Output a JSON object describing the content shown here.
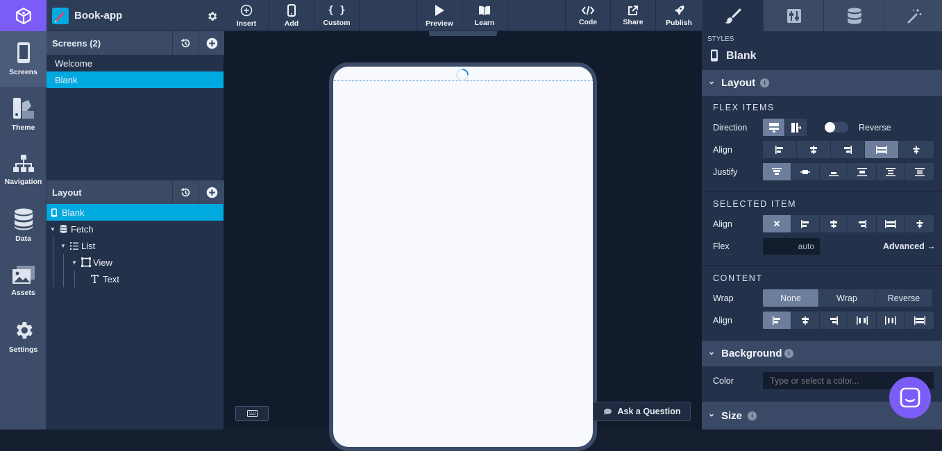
{
  "rail": {
    "items": [
      {
        "label": "Screens",
        "icon": "phone-icon"
      },
      {
        "label": "Theme",
        "icon": "theme-icon"
      },
      {
        "label": "Navigation",
        "icon": "sitemap-icon"
      },
      {
        "label": "Data",
        "icon": "database-icon"
      },
      {
        "label": "Assets",
        "icon": "images-icon"
      },
      {
        "label": "Settings",
        "icon": "gear-icon"
      }
    ]
  },
  "app": {
    "name": "Book-app"
  },
  "screens": {
    "title": "Screens (2)",
    "items": [
      "Welcome",
      "Blank"
    ],
    "selected": "Blank"
  },
  "layout_tree": {
    "title": "Layout",
    "nodes": [
      {
        "label": "Blank",
        "icon": "phone-icon"
      },
      {
        "label": "Fetch",
        "icon": "database-icon"
      },
      {
        "label": "List",
        "icon": "list-icon"
      },
      {
        "label": "View",
        "icon": "view-icon"
      },
      {
        "label": "Text",
        "icon": "text-icon"
      }
    ]
  },
  "toolbar": {
    "insert": "Insert",
    "add": "Add",
    "custom": "Custom",
    "preview": "Preview",
    "learn": "Learn",
    "code": "Code",
    "share": "Share",
    "publish": "Publish"
  },
  "canvas": {
    "ask": "Ask a Question"
  },
  "styles": {
    "header": "STYLES",
    "target": "Blank",
    "layout_section": "Layout",
    "flex_items": "FLEX ITEMS",
    "direction": "Direction",
    "reverse": "Reverse",
    "align": "Align",
    "justify": "Justify",
    "selected_item": "SELECTED ITEM",
    "sel_align": "Align",
    "flex": "Flex",
    "flex_value": "auto",
    "advanced": "Advanced →",
    "content": "CONTENT",
    "wrap": "Wrap",
    "wrap_options": [
      "None",
      "Wrap",
      "Reverse"
    ],
    "wrap_selected": "None",
    "content_align": "Align",
    "background_section": "Background",
    "color": "Color",
    "color_placeholder": "Type or select a color...",
    "size_section": "Size"
  },
  "colors": {
    "brand": "#7c5cf6",
    "selection": "#00a9e0",
    "chat": "#7c5cf6"
  }
}
